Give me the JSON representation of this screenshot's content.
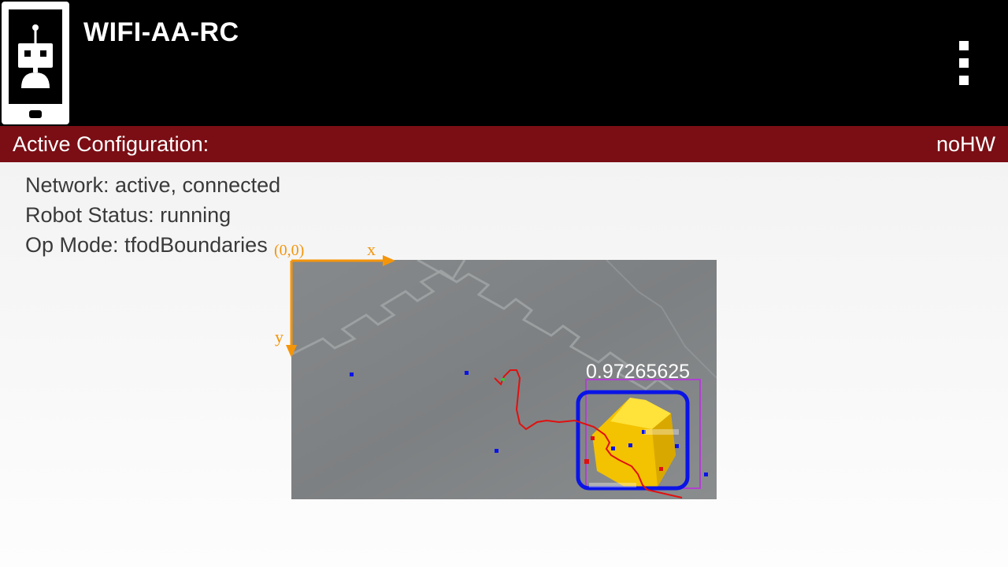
{
  "app_bar": {
    "title": "WIFI-AA-RC",
    "icon": "robot-phone-icon",
    "menu_icon": "overflow-menu-icon"
  },
  "config_bar": {
    "label": "Active Configuration:",
    "value": "noHW",
    "color": "#7a0e14"
  },
  "status": {
    "network": "Network: active, connected",
    "robot_status": "Robot Status: running",
    "op_mode": "Op Mode: tfodBoundaries"
  },
  "overlay": {
    "origin_label": "(0,0)",
    "x_label": "x",
    "y_label": "y",
    "axis_color": "#f5950a"
  },
  "detection": {
    "confidence": "0.97265625",
    "box_color": "#0a14e6",
    "bounds_color": "#b040d0",
    "path_color": "#e01010"
  }
}
